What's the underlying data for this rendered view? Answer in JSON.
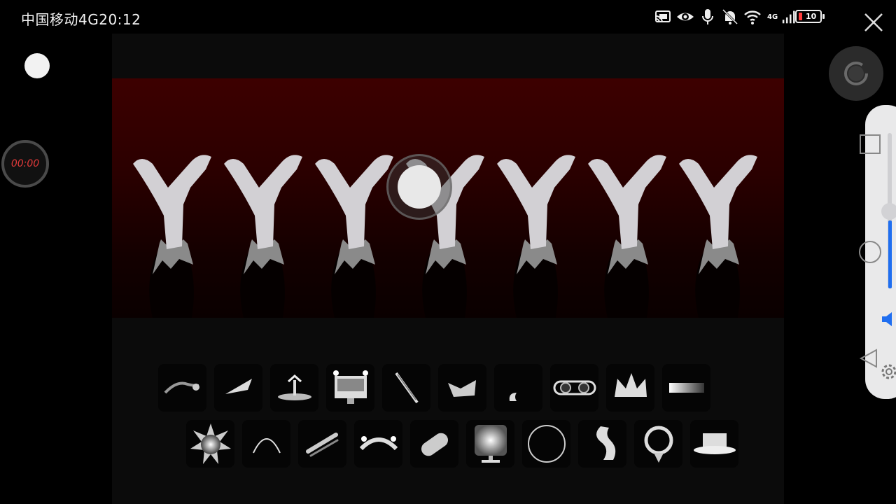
{
  "status_bar": {
    "carrier_time": "中国移动4G20:12",
    "network": "4G",
    "battery_level": "10",
    "icons": [
      "cast-icon",
      "eye-icon",
      "microphone-icon",
      "mute-bell-icon",
      "wifi-icon",
      "signal-icon",
      "battery-icon"
    ]
  },
  "recorder": {
    "timer": "00:00",
    "timer_color": "#e23a3a"
  },
  "stage": {
    "background_colors": [
      "#3d0000",
      "#0a0000"
    ],
    "character_count": 7
  },
  "palette": {
    "row1": [
      "swoosh-tool",
      "blade-tool",
      "fountain-tool",
      "monitor-tool",
      "sword-tool",
      "bird-tool",
      "small-shape-tool",
      "goggles-tool",
      "crown-tool",
      "gradient-bar-tool"
    ],
    "row2": [
      "star-burst-tool",
      "arc-tool",
      "slash-tool",
      "crab-claw-tool",
      "capsule-tool",
      "lamp-tool",
      "ring-tool",
      "hook-tool",
      "medal-tool",
      "hat-tool"
    ]
  },
  "nav": {
    "volume_level": 0.44,
    "accent": "#1f6ef0"
  }
}
